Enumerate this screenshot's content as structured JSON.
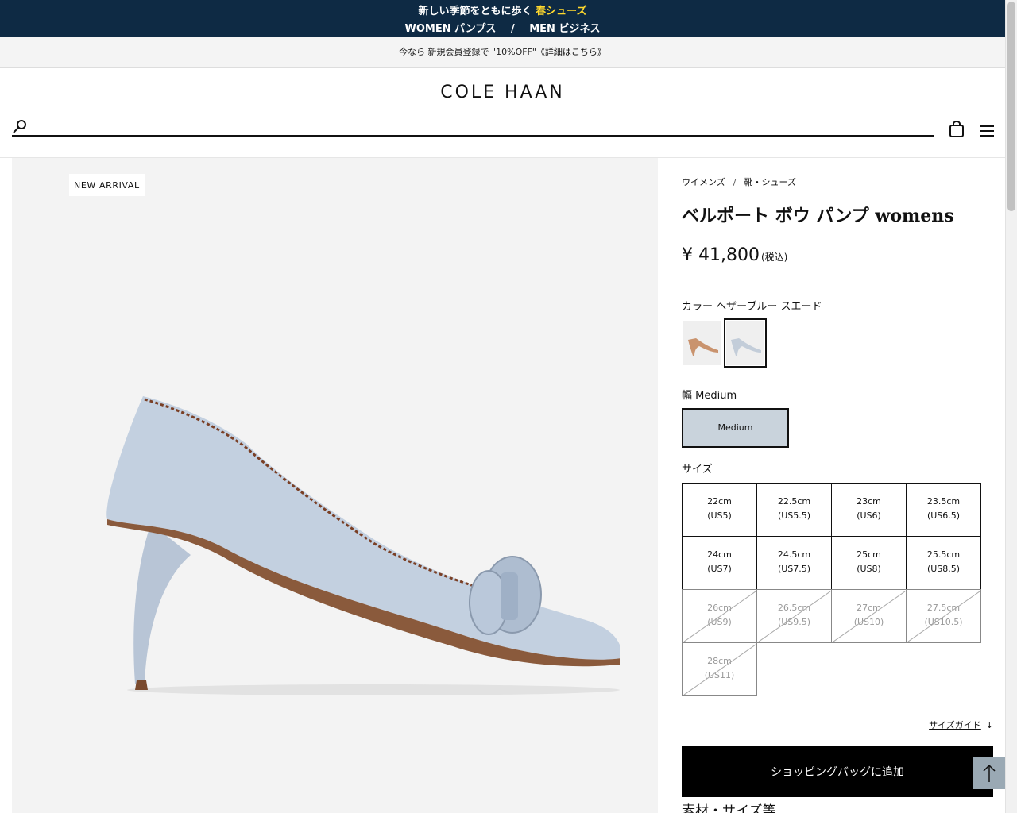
{
  "promo": {
    "line1_text": "新しい季節をともに歩く",
    "line1_highlight": "春シューズ",
    "link_women": "WOMEN パンプス",
    "separator": "/",
    "link_men": "MEN ビジネス"
  },
  "notice": {
    "text": "今なら 新規会員登録で \"10%OFF\"",
    "link": "《詳細はこちら》"
  },
  "header": {
    "logo": "COLE HAAN",
    "search_placeholder": ""
  },
  "gallery": {
    "badge": "NEW ARRIVAL",
    "shoe_color": "#c3d0e0"
  },
  "product": {
    "breadcrumbs": [
      "ウイメンズ",
      "靴・シューズ"
    ],
    "title": "ベルポート ボウ パンプ womens",
    "price": "¥ 41,800",
    "tax_note": "(税込)",
    "color_label": "カラー ヘザーブルー スエード",
    "swatches": [
      {
        "name": "tan",
        "color": "#c9936e",
        "selected": false
      },
      {
        "name": "heather-blue",
        "color": "#c3cdd9",
        "selected": true
      }
    ],
    "width_label": "幅 Medium",
    "width_option": "Medium",
    "size_label": "サイズ",
    "sizes": [
      {
        "line1": "22cm",
        "line2": "(US5)",
        "available": true
      },
      {
        "line1": "22.5cm",
        "line2": "(US5.5)",
        "available": true
      },
      {
        "line1": "23cm",
        "line2": "(US6)",
        "available": true
      },
      {
        "line1": "23.5cm",
        "line2": "(US6.5)",
        "available": true
      },
      {
        "line1": "24cm",
        "line2": "(US7)",
        "available": true
      },
      {
        "line1": "24.5cm",
        "line2": "(US7.5)",
        "available": true
      },
      {
        "line1": "25cm",
        "line2": "(US8)",
        "available": true
      },
      {
        "line1": "25.5cm",
        "line2": "(US8.5)",
        "available": true
      },
      {
        "line1": "26cm",
        "line2": "(US9)",
        "available": false
      },
      {
        "line1": "26.5cm",
        "line2": "(US9.5)",
        "available": false
      },
      {
        "line1": "27cm",
        "line2": "(US10)",
        "available": false
      },
      {
        "line1": "27.5cm",
        "line2": "(US10.5)",
        "available": false
      },
      {
        "line1": "28cm",
        "line2": "(US11)",
        "available": false
      }
    ],
    "size_guide": "サイズガイド",
    "size_guide_arrow": "↓",
    "add_to_bag": "ショッピングバッグに追加",
    "section_heading": "素材・サイズ等"
  },
  "colors": {
    "banner_bg": "#0e2a44",
    "banner_highlight": "#ffd92e",
    "width_selected_bg": "#c9d3dc",
    "back_to_top": "#9aa9b4"
  }
}
